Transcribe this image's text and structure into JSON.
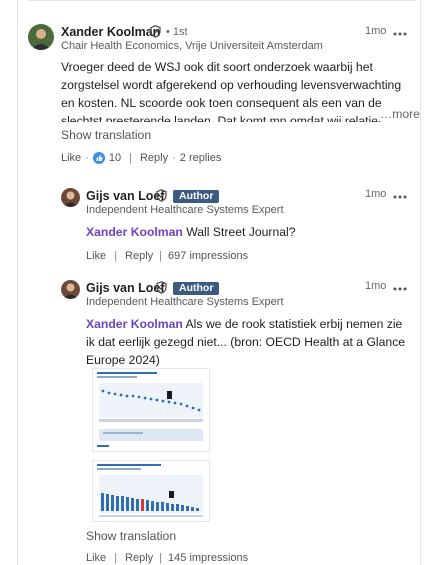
{
  "comment": {
    "author": "Xander Koolman",
    "degree": "• 1st",
    "headline": "Chair Health Economics, Vrije Universiteit Amsterdam",
    "time": "1mo",
    "text": "Vroeger deed de WSJ ook dit soort onderzoek waarbij het zorgstelsel wordt afgerekend op verhouding levensverwachting en kosten. NL scoorde ook toen consequent als een van de slechtst presterende landen. Dat komt mn omdat wij relatief weinig ingrijpen op on",
    "see_more": "…more",
    "show_translation": "Show translation",
    "like_label": "Like",
    "reaction_count": "10",
    "reply_label": "Reply",
    "replies_count": "2 replies"
  },
  "replies": [
    {
      "author": "Gijs van Loef",
      "badge": "Author",
      "headline": "Independent Healthcare Systems Expert",
      "time": "1mo",
      "mention": "Xander Koolman",
      "text": " Wall Street Journal?",
      "like_label": "Like",
      "reply_label": "Reply",
      "impressions": "697 impressions"
    },
    {
      "author": "Gijs van Loef",
      "badge": "Author",
      "headline": "Independent Healthcare Systems Expert",
      "time": "1mo",
      "mention": "Xander Koolman",
      "text": " Als we de rook statistiek erbij nemen zie ik dat eerlijk gezegd niet... (bron: OECD Health at a Glance Europe 2024)",
      "show_translation": "Show translation",
      "like_label": "Like",
      "reply_label": "Reply",
      "impressions": "145 impressions"
    }
  ],
  "icons": {
    "verified": "verified-shield-icon",
    "more": "more-options-icon",
    "reaction": "like-reaction-icon"
  },
  "colors": {
    "mention": "#6b44c2",
    "author_badge": "#3d5a80",
    "reaction": "#378fe9"
  }
}
